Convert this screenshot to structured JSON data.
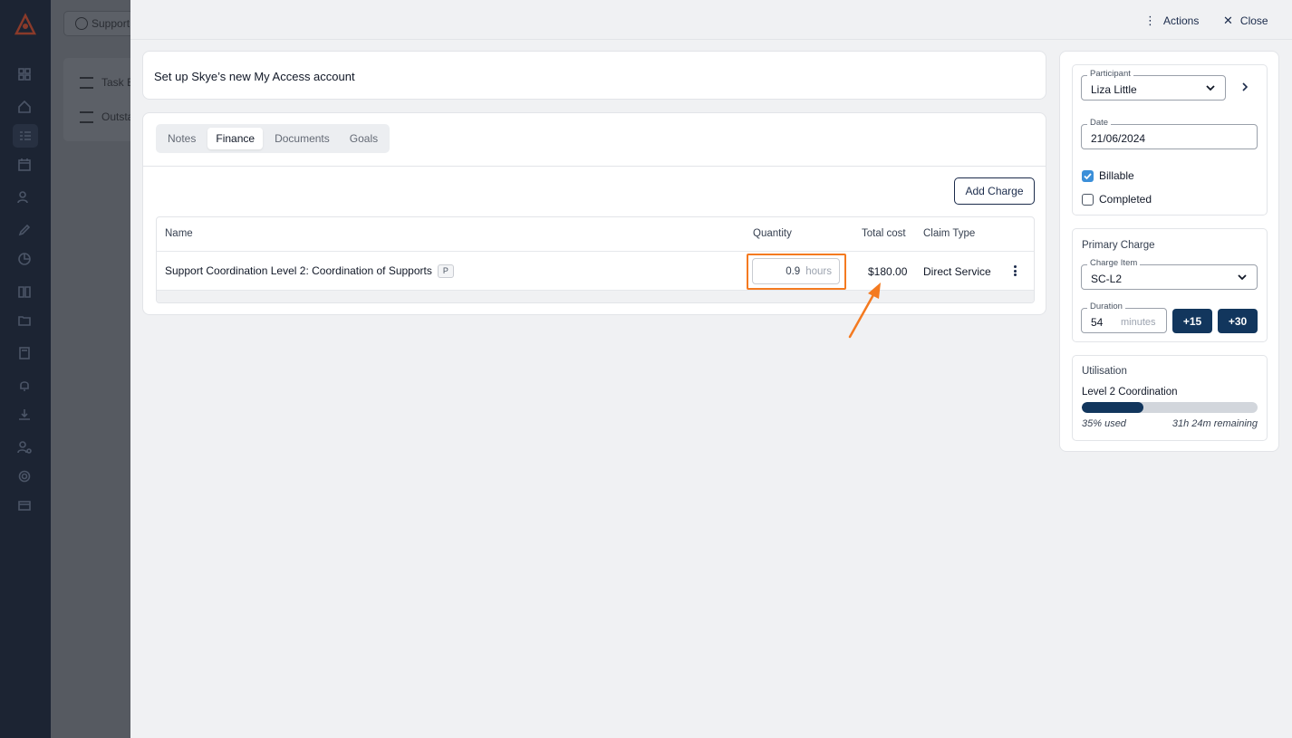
{
  "app": {
    "brand_color": "#12365d",
    "accent_orange": "#f47a20"
  },
  "background": {
    "support_button": "Support",
    "card_items": [
      "Task B",
      "Outsta"
    ]
  },
  "header": {
    "actions_label": "Actions",
    "close_label": "Close"
  },
  "task": {
    "title": "Set up Skye’s new My Access account"
  },
  "tabs": [
    {
      "label": "Notes",
      "active": false
    },
    {
      "label": "Finance",
      "active": true
    },
    {
      "label": "Documents",
      "active": false
    },
    {
      "label": "Goals",
      "active": false
    }
  ],
  "finance": {
    "add_charge_label": "Add Charge",
    "columns": {
      "name": "Name",
      "quantity": "Quantity",
      "total_cost": "Total cost",
      "claim_type": "Claim Type"
    },
    "rows": [
      {
        "name": "Support Coordination Level 2: Coordination of Supports",
        "badge": "P",
        "quantity": "0.9",
        "quantity_unit": "hours",
        "total_cost": "$180.00",
        "claim_type": "Direct Service"
      }
    ]
  },
  "sidebar": {
    "participant_label": "Participant",
    "participant_value": "Liza Little",
    "date_label": "Date",
    "date_value": "21/06/2024",
    "billable_label": "Billable",
    "billable_checked": true,
    "completed_label": "Completed",
    "completed_checked": false,
    "primary_charge_title": "Primary Charge",
    "charge_item_label": "Charge Item",
    "charge_item_value": "SC-L2",
    "duration_label": "Duration",
    "duration_value": "54",
    "duration_unit": "minutes",
    "add15_label": "+15",
    "add30_label": "+30",
    "utilisation_title": "Utilisation",
    "utilisation_name": "Level 2 Coordination",
    "utilisation_used_fraction": 0.35,
    "utilisation_used_text": "35% used",
    "utilisation_remaining_text": "31h 24m remaining"
  }
}
